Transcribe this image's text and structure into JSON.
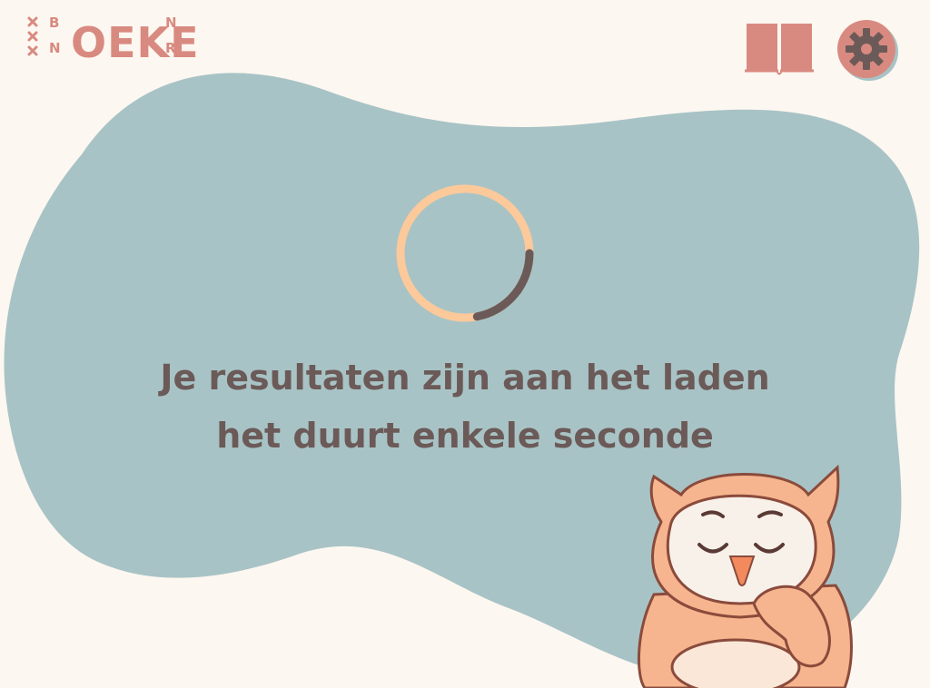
{
  "brand": {
    "logo_text": "OEKE",
    "logo_letters_left": [
      "B",
      "N"
    ],
    "logo_letters_right": [
      "N",
      "R"
    ]
  },
  "header": {
    "book_icon": "book-icon",
    "settings_icon": "gear-icon"
  },
  "loading": {
    "line1": "Je resultaten zijn aan het laden",
    "line2": "het duurt enkele seconde",
    "progress": 0.22
  },
  "colors": {
    "background": "#fdf7f1",
    "blob": "#a8c3c5",
    "accent_pink": "#d98a80",
    "spinner_track": "#fcc99b",
    "spinner_arc": "#6b5a58",
    "text": "#6b5a58"
  },
  "mascot": "sleeping-owl"
}
